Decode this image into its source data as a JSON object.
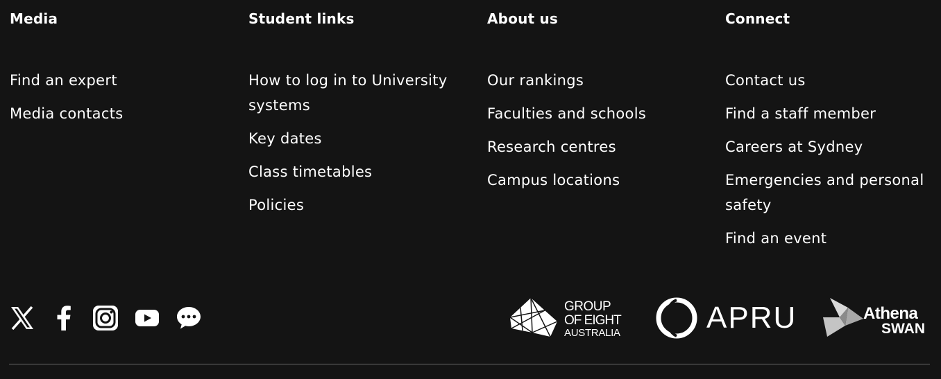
{
  "columns": [
    {
      "heading": "Media",
      "links": [
        "Find an expert",
        "Media contacts"
      ]
    },
    {
      "heading": "Student links",
      "links": [
        "How to log in to University systems",
        "Key dates",
        "Class timetables",
        "Policies"
      ]
    },
    {
      "heading": "About us",
      "links": [
        "Our rankings",
        "Faculties and schools",
        "Research centres",
        "Campus locations"
      ]
    },
    {
      "heading": "Connect",
      "links": [
        "Contact us",
        "Find a staff member",
        "Careers at Sydney",
        "Emergencies and personal safety",
        "Find an event"
      ]
    }
  ],
  "social_icons": [
    "x-icon",
    "facebook-icon",
    "instagram-icon",
    "youtube-icon",
    "wechat-icon"
  ],
  "partner_logos": {
    "go8": {
      "line1": "GROUP",
      "line2": "OF EIGHT",
      "line3": "AUSTRALIA"
    },
    "apru": {
      "text": "APRU"
    },
    "athena": {
      "line1": "Athena",
      "line2": "SWAN"
    }
  },
  "colors": {
    "background": "#141414",
    "text": "#ffffff",
    "divider": "#6a6a6a"
  }
}
